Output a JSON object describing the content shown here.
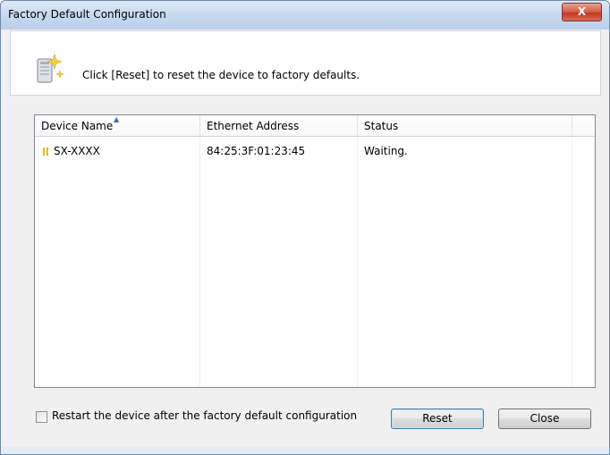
{
  "window": {
    "title": "Factory Default Configuration",
    "close_label": "X"
  },
  "header": {
    "instruction": "Click [Reset] to reset the device to factory defaults."
  },
  "list": {
    "columns": [
      "Device Name",
      "Ethernet Address",
      "Status"
    ],
    "rows": [
      {
        "device_name": "SX-XXXX",
        "ethernet_address": "84:25:3F:01:23:45",
        "status": "Waiting."
      }
    ]
  },
  "options": {
    "restart_label": "Restart the device after the factory default configuration",
    "restart_checked": false
  },
  "buttons": {
    "reset_label": "Reset",
    "close_label": "Close"
  }
}
